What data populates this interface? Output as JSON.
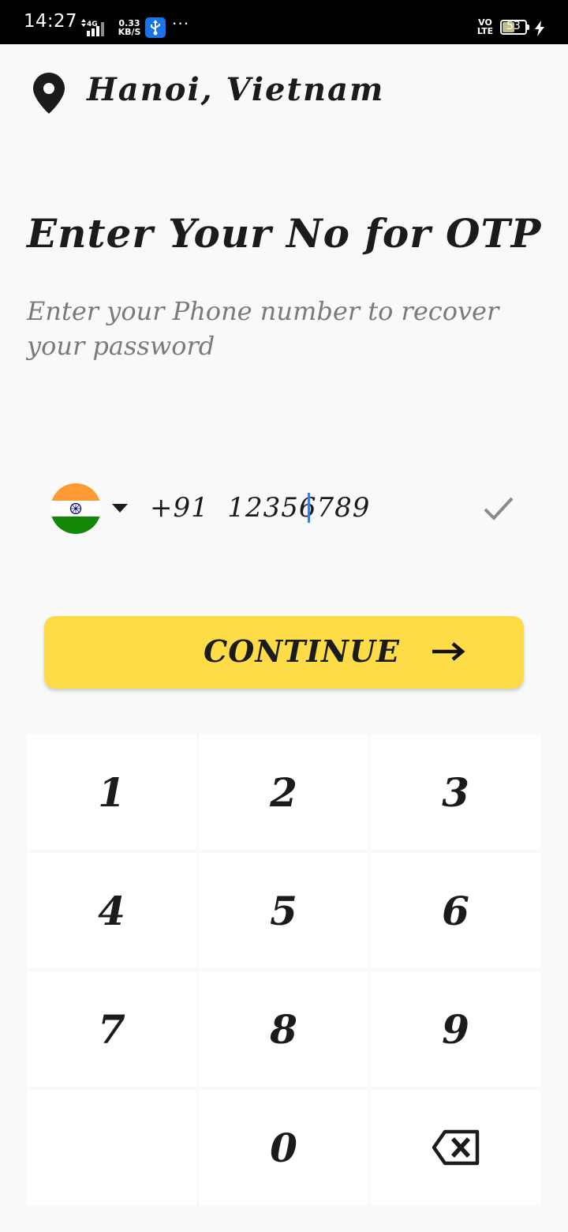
{
  "status_bar": {
    "time": "14:27",
    "network": "4G",
    "speed_value": "0.33",
    "speed_unit": "KB/S",
    "more": "···",
    "volte_top": "VO",
    "volte_bottom": "LTE",
    "battery_level": "53",
    "icons": [
      "signal-icon",
      "usb-icon",
      "battery-icon",
      "charging-bolt-icon"
    ]
  },
  "location": {
    "icon": "location-pin-icon",
    "text": "Hanoi,  Vietnam"
  },
  "title": "Enter Your No for OTP",
  "subtitle": "Enter your Phone number to recover your password",
  "phone": {
    "country_flag": "india-flag-icon",
    "dropdown_icon": "caret-down-icon",
    "value": "+91  12356789",
    "valid_icon": "checkmark-icon"
  },
  "continue_button": {
    "label": "CONTINUE",
    "icon": "arrow-right-icon",
    "color": "#fddc47"
  },
  "keypad": {
    "keys": [
      "1",
      "2",
      "3",
      "4",
      "5",
      "6",
      "7",
      "8",
      "9",
      "",
      "0"
    ],
    "backspace_icon": "backspace-icon"
  },
  "colors": {
    "background": "#f9f9f9",
    "accent_yellow": "#fddc47",
    "cursor_blue": "#2f80ed",
    "subtitle_gray": "#7a7a7a"
  }
}
